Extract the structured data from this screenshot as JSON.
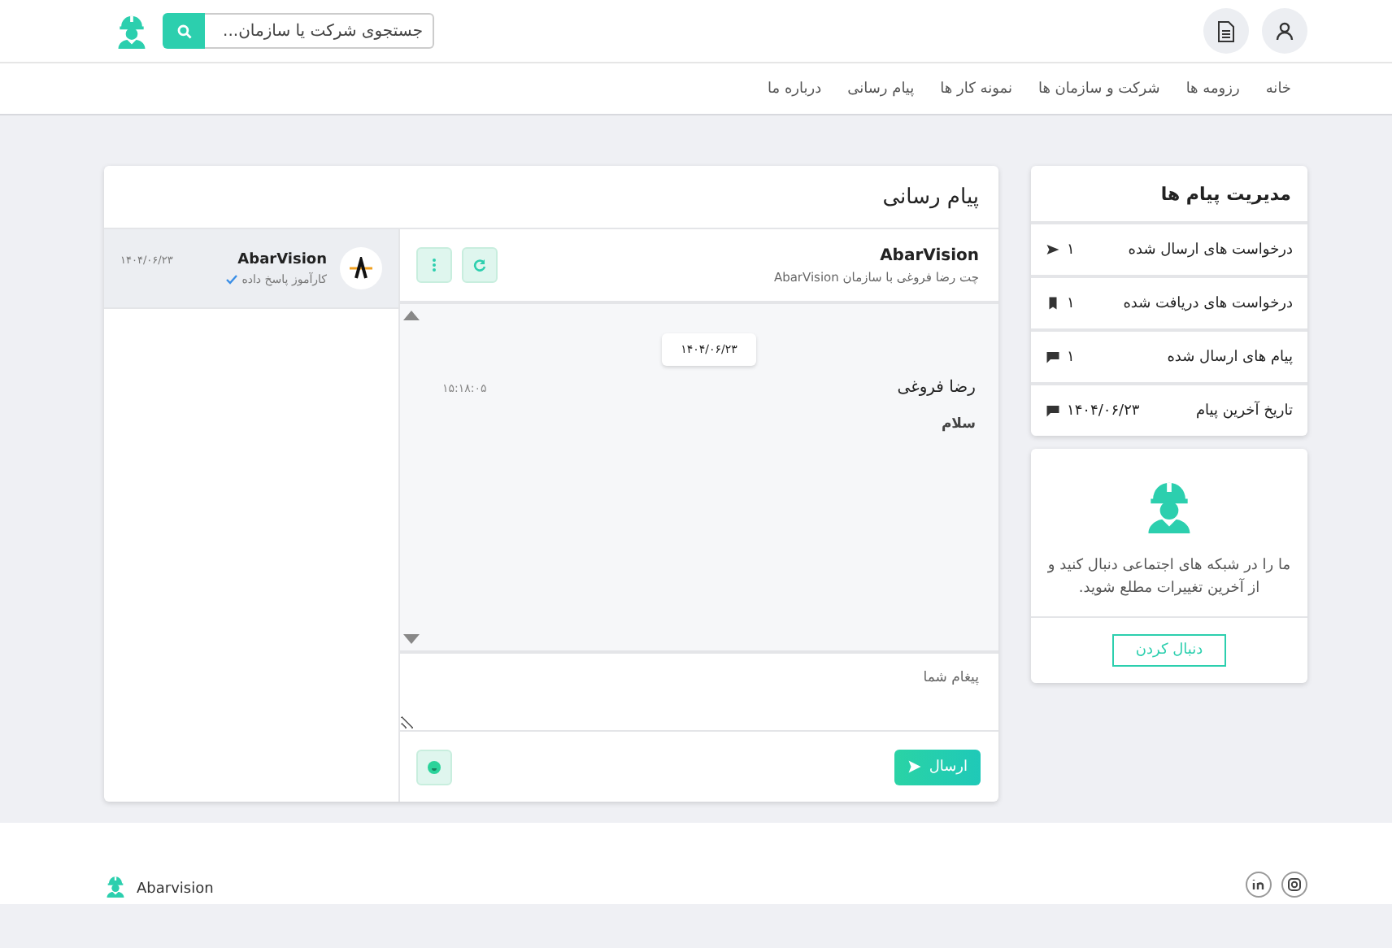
{
  "header": {
    "search": {
      "placeholder": "جستجوی شرکت یا سازمان..."
    }
  },
  "nav": [
    {
      "label": "خانه"
    },
    {
      "label": "رزومه ها"
    },
    {
      "label": "شرکت و سازمان ها"
    },
    {
      "label": "نمونه کار ها"
    },
    {
      "label": "پیام رسانی"
    },
    {
      "label": "درباره ما"
    }
  ],
  "sidebar": {
    "title": "مدیریت پیام ها",
    "stats": [
      {
        "label": "درخواست های ارسال شده",
        "value": "۱"
      },
      {
        "label": "درخواست های دریافت شده",
        "value": "۱"
      },
      {
        "label": "پیام های ارسال شده",
        "value": "۱"
      },
      {
        "label": "تاریخ آخرین پیام",
        "value": "۱۴۰۴/۰۶/۲۳"
      }
    ],
    "follow": {
      "text": "ما را در شبکه های اجتماعی دنبال کنید و از آخرین تغییرات مطلع شوید.",
      "button": "دنبال کردن"
    }
  },
  "messaging": {
    "title": "پیام رسانی",
    "chat": {
      "name": "AbarVision",
      "subtitle": "چت رضا فروغی با سازمان AbarVision",
      "messages": [
        {
          "date": "۱۴۰۴/۰۶/۲۳",
          "sender": "رضا فروغی",
          "time": "۱۵:۱۸:۰۵",
          "text": "سلام"
        }
      ],
      "input": {
        "placeholder": "پیغام شما"
      },
      "send": "ارسال"
    },
    "conversations": [
      {
        "name": "AbarVision",
        "date": "۱۴۰۴/۰۶/۲۳",
        "preview": "کارآموز پاسخ داده",
        "selected": true
      }
    ]
  },
  "footer": {
    "brand": "Abarvision"
  }
}
